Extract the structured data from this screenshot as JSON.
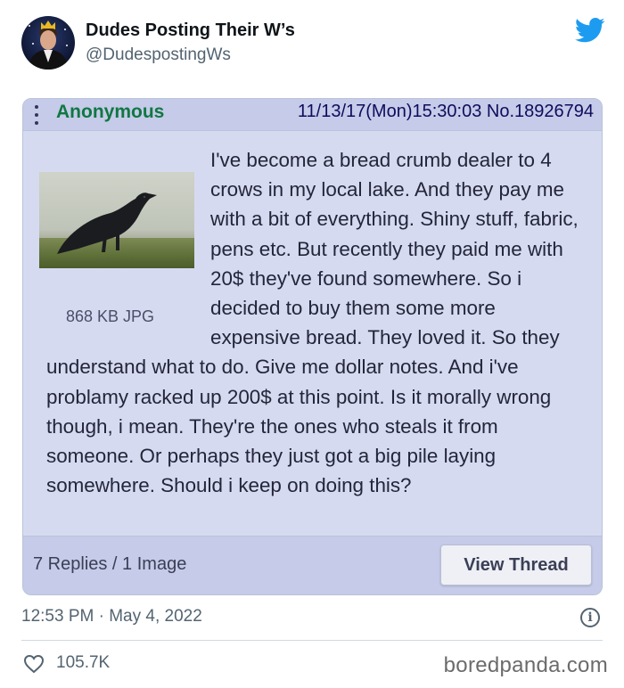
{
  "tweet": {
    "display_name": "Dudes Posting Their W’s",
    "handle": "@DudespostingWs",
    "timestamp": "12:53 PM · May 4, 2022",
    "likes": "105.7K"
  },
  "post": {
    "poster_name": "Anonymous",
    "meta": "11/13/17(Mon)15:30:03 No.18926794",
    "file_info": "868 KB JPG",
    "body": "I've become a bread crumb dealer to 4 crows in my local lake. And they pay me with a bit of everything. Shiny stuff, fabric, pens etc. But recently they paid me with 20$ they've found somewhere. So i decided to buy them some more expensive bread. They loved it. So they understand what to do. Give me dollar notes. And i've problamy racked up 200$ at this point. Is it morally wrong though, i mean. They're the ones who steals it from someone. Or perhaps they just got a big pile laying somewhere. Should i keep on doing this?",
    "replies": "7 Replies / 1 Image",
    "view_thread_label": "View Thread"
  },
  "info_icon_glyph": "i",
  "watermark": "boredpanda.com",
  "icons": {
    "twitter": "twitter-bird-icon",
    "menu": "vertical-dots-icon",
    "info": "info-icon",
    "like": "heart-icon"
  },
  "colors": {
    "twitter_blue": "#1d9bf0",
    "post_bg": "#d6daf0",
    "post_header_bg": "#c5cbe8",
    "poster_name": "#117743",
    "secondary_text": "#536471"
  }
}
